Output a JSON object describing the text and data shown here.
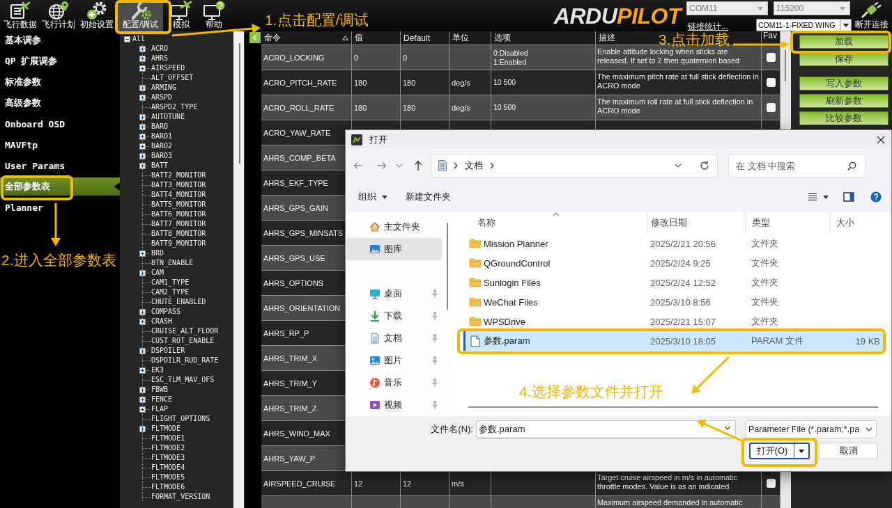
{
  "toolbar": {
    "items": [
      {
        "label": "飞行数据",
        "kind": "data",
        "selected": false
      },
      {
        "label": "飞行计划",
        "kind": "plan",
        "selected": false
      },
      {
        "label": "初始设置",
        "kind": "setup",
        "selected": false
      },
      {
        "label": "配置/调试",
        "kind": "config",
        "selected": true
      },
      {
        "label": "模拟",
        "kind": "sim",
        "selected": false
      },
      {
        "label": "帮助",
        "kind": "help",
        "selected": false
      }
    ],
    "annotation": "1.点击配置/调试"
  },
  "logo": [
    "ARDU",
    "PILOT"
  ],
  "connection": {
    "port": "COM11",
    "baud": "115200",
    "stats_link": "链接统计...",
    "vehicle": "COM11-1-FIXED WING",
    "disconnect": "断开连接"
  },
  "sidebar": {
    "items": [
      {
        "label": "基本调参",
        "selected": false
      },
      {
        "label": "QP 扩展调参",
        "selected": false
      },
      {
        "label": "标准参数",
        "selected": false
      },
      {
        "label": "高级参数",
        "selected": false
      },
      {
        "label": "Onboard OSD",
        "selected": false
      },
      {
        "label": "MAVFtp",
        "selected": false
      },
      {
        "label": "User Params",
        "selected": false
      },
      {
        "label": "全部参数表",
        "selected": true
      },
      {
        "label": "Planner",
        "selected": false
      }
    ],
    "annotation": "2.进入全部参数表"
  },
  "tree": {
    "label": "All",
    "expanded": true,
    "children": [
      {
        "label": "ACRO",
        "kind": "group",
        "expanded": false
      },
      {
        "label": "AHRS",
        "kind": "group",
        "expanded": false
      },
      {
        "label": "AIRSPEED",
        "kind": "group",
        "expanded": false
      },
      {
        "label": "ALT_OFFSET",
        "kind": "param"
      },
      {
        "label": "ARMING",
        "kind": "group",
        "expanded": false
      },
      {
        "label": "ARSPD",
        "kind": "group",
        "expanded": false
      },
      {
        "label": "ARSPD2_TYPE",
        "kind": "param"
      },
      {
        "label": "AUTOTUNE",
        "kind": "group",
        "expanded": false
      },
      {
        "label": "BARO",
        "kind": "group",
        "expanded": false
      },
      {
        "label": "BARO1",
        "kind": "group",
        "expanded": false
      },
      {
        "label": "BARO2",
        "kind": "group",
        "expanded": false
      },
      {
        "label": "BARO3",
        "kind": "group",
        "expanded": false
      },
      {
        "label": "BATT",
        "kind": "group",
        "expanded": false
      },
      {
        "label": "BATT2_MONITOR",
        "kind": "param"
      },
      {
        "label": "BATT3_MONITOR",
        "kind": "param"
      },
      {
        "label": "BATT4_MONITOR",
        "kind": "param"
      },
      {
        "label": "BATT5_MONITOR",
        "kind": "param"
      },
      {
        "label": "BATT6_MONITOR",
        "kind": "param"
      },
      {
        "label": "BATT7_MONITOR",
        "kind": "param"
      },
      {
        "label": "BATT8_MONITOR",
        "kind": "param"
      },
      {
        "label": "BATT9_MONITOR",
        "kind": "param"
      },
      {
        "label": "BRD",
        "kind": "group",
        "expanded": false
      },
      {
        "label": "BTN_ENABLE",
        "kind": "param"
      },
      {
        "label": "CAM",
        "kind": "group",
        "expanded": false
      },
      {
        "label": "CAM1_TYPE",
        "kind": "param"
      },
      {
        "label": "CAM2_TYPE",
        "kind": "param"
      },
      {
        "label": "CHUTE_ENABLED",
        "kind": "param"
      },
      {
        "label": "COMPASS",
        "kind": "group",
        "expanded": false
      },
      {
        "label": "CRASH",
        "kind": "group",
        "expanded": false
      },
      {
        "label": "CRUISE_ALT_FLOOR",
        "kind": "param"
      },
      {
        "label": "CUST_ROT_ENABLE",
        "kind": "param"
      },
      {
        "label": "DSPOILER",
        "kind": "group",
        "expanded": false
      },
      {
        "label": "DSPOILR_RUD_RATE",
        "kind": "param"
      },
      {
        "label": "EK3",
        "kind": "group",
        "expanded": false
      },
      {
        "label": "ESC_TLM_MAV_OFS",
        "kind": "param"
      },
      {
        "label": "FBWB",
        "kind": "group",
        "expanded": false
      },
      {
        "label": "FENCE",
        "kind": "group",
        "expanded": false
      },
      {
        "label": "FLAP",
        "kind": "group",
        "expanded": false
      },
      {
        "label": "FLIGHT_OPTIONS",
        "kind": "param"
      },
      {
        "label": "FLTMODE",
        "kind": "group",
        "expanded": false
      },
      {
        "label": "FLTMODE1",
        "kind": "param"
      },
      {
        "label": "FLTMODE2",
        "kind": "param"
      },
      {
        "label": "FLTMODE3",
        "kind": "param"
      },
      {
        "label": "FLTMODE4",
        "kind": "param"
      },
      {
        "label": "FLTMODE5",
        "kind": "param"
      },
      {
        "label": "FLTMODE6",
        "kind": "param"
      },
      {
        "label": "FORMAT_VERSION",
        "kind": "param"
      }
    ]
  },
  "table": {
    "columns": [
      {
        "label": "命令",
        "sorted": true
      },
      {
        "label": "值",
        "sorted": false
      },
      {
        "label": "Default",
        "sorted": false
      },
      {
        "label": "单位",
        "sorted": false
      },
      {
        "label": "选项",
        "sorted": false
      },
      {
        "label": "描述",
        "sorted": false
      },
      {
        "label": "Fav",
        "sorted": false
      }
    ],
    "rows": [
      {
        "name": "ACRO_LOCKING",
        "value": "0",
        "default": "0",
        "options": [
          "0:Disabled",
          "1:Enabled"
        ],
        "description": "Enable attitude locking when sticks are released. If set to 2 then quaternion based",
        "fav": false
      },
      {
        "name": "ACRO_PITCH_RATE",
        "value": "180",
        "default": "180",
        "unit": "deg/s",
        "options": [
          "10 500"
        ],
        "description": "The maximum pitch rate at full stick deflection in ACRO mode",
        "fav": false
      },
      {
        "name": "ACRO_ROLL_RATE",
        "value": "180",
        "default": "180",
        "unit": "deg/s",
        "options": [
          "10 500"
        ],
        "description": "The maximum roll rate at full stick deflection in ACRO mode",
        "fav": false
      },
      {
        "name": "ACRO_YAW_RATE"
      },
      {
        "name": "AHRS_COMP_BETA"
      },
      {
        "name": "AHRS_EKF_TYPE"
      },
      {
        "name": "AHRS_GPS_GAIN"
      },
      {
        "name": "AHRS_GPS_MINSATS"
      },
      {
        "name": "AHRS_GPS_USE"
      },
      {
        "name": "AHRS_OPTIONS"
      },
      {
        "name": "AHRS_ORIENTATION"
      },
      {
        "name": "AHRS_RP_P"
      },
      {
        "name": "AHRS_TRIM_X"
      },
      {
        "name": "AHRS_TRIM_Y"
      },
      {
        "name": "AHRS_TRIM_Z"
      },
      {
        "name": "AHRS_WIND_MAX"
      },
      {
        "name": "AHRS_YAW_P"
      },
      {
        "name": "AIRSPEED_CRUISE",
        "value": "12",
        "default": "12",
        "unit": "m/s",
        "description": "Target cruise airspeed in m/s in automatic throttle modes. Value is as an indicated",
        "fav": false
      },
      {
        "description": "Maximum airspeed demanded in automatic"
      }
    ]
  },
  "param_buttons": {
    "items": [
      "加载",
      "保存",
      "写入参数",
      "刷新参数",
      "比较参数"
    ],
    "annotation": "3.点击加载"
  },
  "dialog": {
    "title": "打开",
    "breadcrumb": "文档",
    "search": {
      "placeholder": "在 文档 中搜索"
    },
    "organize": "组织",
    "new_folder": "新建文件夹",
    "nav": [
      {
        "label": "主文件夹",
        "kind": "home",
        "pinned": false,
        "selected": false
      },
      {
        "label": "图库",
        "kind": "gallery",
        "pinned": false,
        "selected": true
      },
      {
        "label": "桌面",
        "kind": "desktop",
        "pinned": true,
        "selected": false
      },
      {
        "label": "下载",
        "kind": "downloads",
        "pinned": true,
        "selected": false
      },
      {
        "label": "文档",
        "kind": "documents",
        "pinned": true,
        "selected": false
      },
      {
        "label": "图片",
        "kind": "pictures",
        "pinned": true,
        "selected": false
      },
      {
        "label": "音乐",
        "kind": "music",
        "pinned": true,
        "selected": false
      },
      {
        "label": "视频",
        "kind": "videos",
        "pinned": true,
        "selected": false
      }
    ],
    "columns": [
      "名称",
      "修改日期",
      "类型",
      "大小"
    ],
    "files": [
      {
        "name": "Mission Planner",
        "modified": "2025/2/21 20:56",
        "type": "文件夹",
        "kind": "folder",
        "selected": false
      },
      {
        "name": "QGroundControl",
        "modified": "2025/2/24 9:25",
        "type": "文件夹",
        "kind": "folder",
        "selected": false
      },
      {
        "name": "Sunlogin Files",
        "modified": "2025/2/24 12:52",
        "type": "文件夹",
        "kind": "folder",
        "selected": false
      },
      {
        "name": "WeChat Files",
        "modified": "2025/3/10 8:56",
        "type": "文件夹",
        "kind": "folder",
        "selected": false
      },
      {
        "name": "WPSDrive",
        "modified": "2025/2/21 15:07",
        "type": "文件夹",
        "kind": "folder",
        "selected": false
      },
      {
        "name": "参数.param",
        "modified": "2025/3/10 18:05",
        "type": "PARAM 文件",
        "size": "19 KB",
        "kind": "file",
        "selected": true
      }
    ],
    "filename_label": "文件名(N):",
    "filename": "参数.param",
    "filetype": "Parameter File (*.param;*.pa",
    "open": "打开(O)",
    "cancel": "取消",
    "annotation": "4.选择参数文件并打开"
  }
}
